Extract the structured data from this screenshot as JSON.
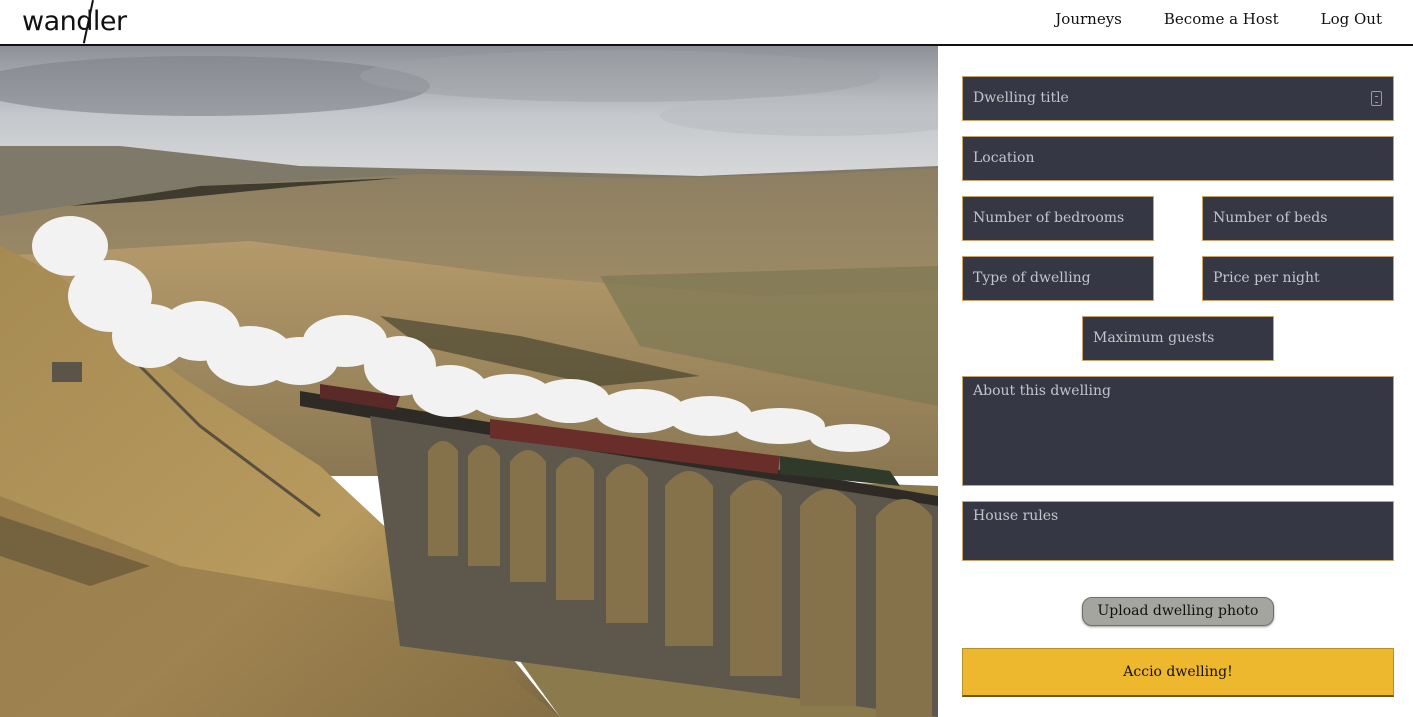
{
  "header": {
    "logo_text": "wandler",
    "nav": [
      {
        "label": "Journeys"
      },
      {
        "label": "Become a Host"
      },
      {
        "label": "Log Out"
      }
    ]
  },
  "form": {
    "dwelling_title": {
      "placeholder": "Dwelling title",
      "value": ""
    },
    "location": {
      "placeholder": "Location",
      "value": ""
    },
    "bedrooms": {
      "placeholder": "Number of bedrooms",
      "value": ""
    },
    "beds": {
      "placeholder": "Number of beds",
      "value": ""
    },
    "dwelling_type": {
      "placeholder": "Type of dwelling",
      "value": ""
    },
    "price": {
      "placeholder": "Price per night",
      "value": ""
    },
    "max_guests": {
      "placeholder": "Maximum guests",
      "value": ""
    },
    "about": {
      "placeholder": "About this dwelling",
      "value": ""
    },
    "house_rules": {
      "placeholder": "House rules",
      "value": ""
    },
    "upload_label": "Upload dwelling photo",
    "submit_label": "Accio dwelling!"
  },
  "colors": {
    "field_bg": "#353744",
    "field_border": "#c9a36a",
    "submit_bg": "#eeb82e",
    "upload_bg": "#a4a59e"
  }
}
